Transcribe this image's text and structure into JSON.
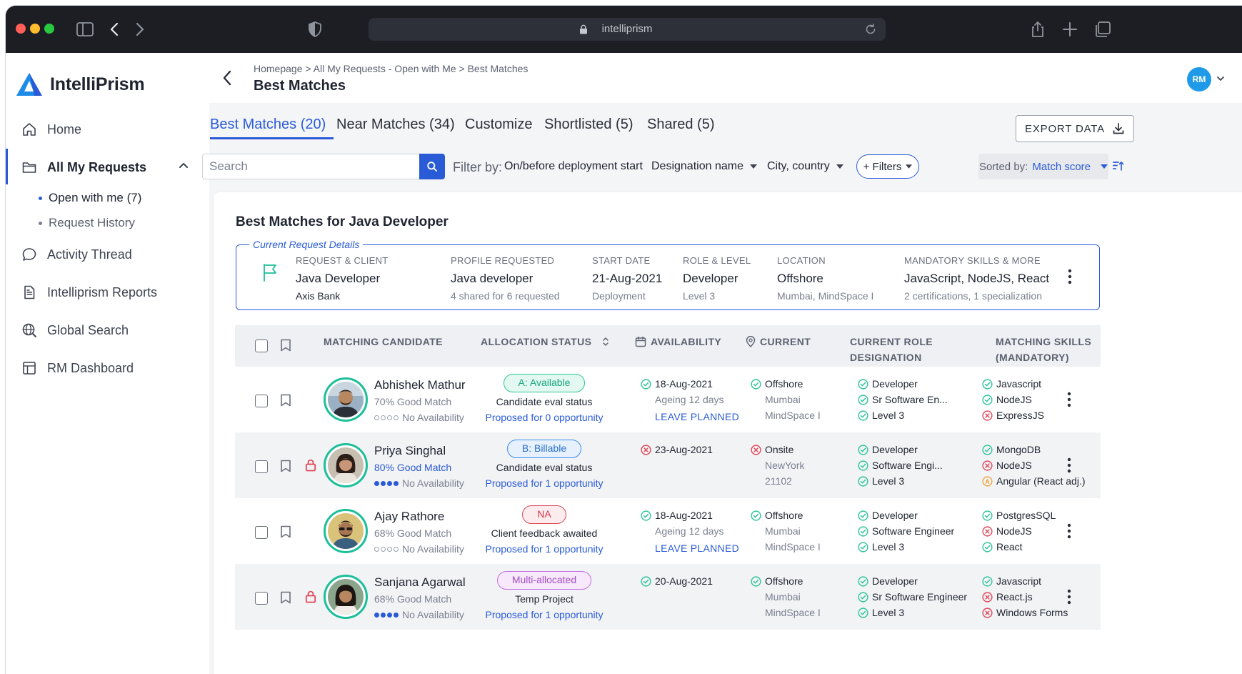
{
  "browser": {
    "url": "intelliprism",
    "colors": {
      "close": "#ff5f57",
      "minimize": "#febc2e",
      "maximize": "#28c840"
    }
  },
  "app": {
    "name": "IntelliPrism"
  },
  "sidebar": {
    "items": [
      {
        "label": "Home",
        "icon": "home-icon"
      },
      {
        "label": "All My Requests",
        "icon": "folder-icon"
      },
      {
        "label": "Activity Thread",
        "icon": "chat-bubble-icon"
      },
      {
        "label": "Intelliprism Reports",
        "icon": "document-icon"
      },
      {
        "label": "Global Search",
        "icon": "globe-search-icon"
      },
      {
        "label": "RM Dashboard",
        "icon": "dashboard-icon"
      }
    ],
    "sub_items": [
      "Open with me (7)",
      "Request History"
    ]
  },
  "header": {
    "breadcrumb": "Homepage > All My Requests - Open with Me > Best Matches",
    "title": "Best Matches",
    "avatar": "RM"
  },
  "tabs": [
    "Best Matches (20)",
    "Near Matches (34)",
    "Customize",
    "Shortlisted (5)",
    "Shared (5)"
  ],
  "export_label": "EXPORT DATA",
  "filters": {
    "search_placeholder": "Search",
    "label": "Filter by:",
    "deployment": "On/before deployment start",
    "designation": "Designation name",
    "city": "City, country",
    "more": "+ Filters",
    "sort_label": "Sorted by:",
    "sort_value": "Match score"
  },
  "card": {
    "title": "Best Matches for Java Developer",
    "legend": "Current Request Details",
    "request": {
      "client_h": "REQUEST & CLIENT",
      "client_v": "Java Developer",
      "client_s": "Axis Bank",
      "profile_h": "PROFILE REQUESTED",
      "profile_v": "Java developer",
      "profile_s": "4 shared for 6 requested",
      "start_h": "START DATE",
      "start_v": "21-Aug-2021",
      "start_s": "Deployment",
      "role_h": "ROLE & LEVEL",
      "role_v": "Developer",
      "role_s": "Level 3",
      "loc_h": "LOCATION",
      "loc_v": "Offshore",
      "loc_s": "Mumbai, MindSpace I",
      "skills_h": "MANDATORY SKILLS & MORE",
      "skills_v": "JavaScript, NodeJS, React",
      "skills_s": "2 certifications, 1 specialization"
    }
  },
  "table": {
    "headers": {
      "candidate": "MATCHING CANDIDATE",
      "allocation": "ALLOCATION STATUS",
      "availability": "AVAILABILITY",
      "current": "CURRENT",
      "role_1": "CURRENT ROLE",
      "role_2": "DESIGNATION",
      "skills_1": "MATCHING SKILLS",
      "skills_2": "(MANDATORY)"
    },
    "rows": [
      {
        "name": "Abhishek Mathur",
        "match": "70% Good Match",
        "availability": "No Availability",
        "badge": "A: Available",
        "status": "Candidate eval status",
        "proposed": "Proposed for 0 opportunity",
        "avail_date": "18-Aug-2021",
        "ageing": "Ageing 12 days",
        "leave": "LEAVE PLANNED",
        "current": "Offshore",
        "city": "Mumbai",
        "site": "MindSpace I",
        "role": "Developer",
        "designation": "Sr Software En...",
        "level": "Level 3",
        "skill1": "Javascript",
        "skill2": "NodeJS",
        "skill3": "ExpressJS"
      },
      {
        "name": "Priya Singhal",
        "match": "80% Good Match",
        "availability": "No Availability",
        "badge": "B: Billable",
        "status": "Candidate eval status",
        "proposed": "Proposed for 1 opportunity",
        "avail_date": "23-Aug-2021",
        "current": "Onsite",
        "city": "NewYork",
        "site": "21102",
        "role": "Developer",
        "designation": "Software Engi...",
        "level": "Level 3",
        "skill1": "MongoDB",
        "skill2": "NodeJS",
        "skill3": "Angular (React adj.)"
      },
      {
        "name": "Ajay Rathore",
        "match": "68% Good Match",
        "availability": "No Availability",
        "badge": "NA",
        "status": "Client feedback awaited",
        "proposed": "Proposed for 1 opportunity",
        "avail_date": "18-Aug-2021",
        "ageing": "Ageing 12 days",
        "leave": "LEAVE PLANNED",
        "current": "Offshore",
        "city": "Mumbai",
        "site": "MindSpace I",
        "role": "Developer",
        "designation": "Software Engineer",
        "level": "Level 3",
        "skill1": "PostgresSQL",
        "skill2": "NodeJS",
        "skill3": "React"
      },
      {
        "name": "Sanjana Agarwal",
        "match": "68% Good Match",
        "availability": "No Availability",
        "badge": "Multi-allocated",
        "status": "Temp Project",
        "proposed": "Proposed for 1 opportunity",
        "avail_date": "20-Aug-2021",
        "current": "Offshore",
        "city": "Mumbai",
        "site": "MindSpace I",
        "role": "Developer",
        "designation": "Sr Software Engineer",
        "level": "Level 3",
        "skill1": "Javascript",
        "skill2": "React.js",
        "skill3": "Windows Forms"
      }
    ]
  },
  "colors": {
    "accent": "#2a5bd7",
    "ok": "#2fc59a",
    "bad": "#e0475a",
    "warn": "#f0a640"
  }
}
